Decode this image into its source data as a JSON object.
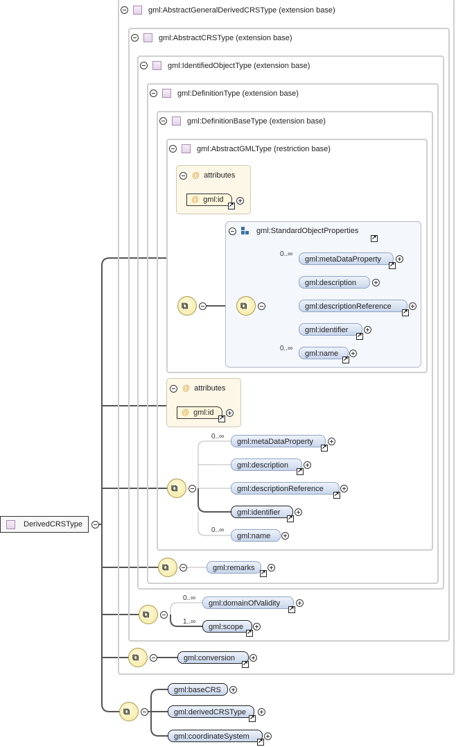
{
  "root": {
    "label": "DerivedCRSType"
  },
  "types": {
    "agd": "gml:AbstractGeneralDerivedCRSType (extension base)",
    "acrs": "gml:AbstractCRSType (extension base)",
    "ido": "gml:IdentifiedObjectType (extension base)",
    "def": "gml:DefinitionType (extension base)",
    "defbase": "gml:DefinitionBaseType (extension base)",
    "agml": "gml:AbstractGMLType (restriction base)"
  },
  "attributes": {
    "title": "attributes",
    "id": "gml:id"
  },
  "group": {
    "name": "gml:StandardObjectProperties"
  },
  "occurrence": {
    "many0": "0..∞",
    "many1": "1..∞"
  },
  "elements": {
    "metaDataProperty": "gml:metaDataProperty",
    "description": "gml:description",
    "descriptionReference": "gml:descriptionReference",
    "identifier": "gml:identifier",
    "name": "gml:name",
    "remarks": "gml:remarks",
    "domainOfValidity": "gml:domainOfValidity",
    "scope": "gml:scope",
    "conversion": "gml:conversion",
    "baseCRS": "gml:baseCRS",
    "derivedCRSType": "gml:derivedCRSType",
    "coordinateSystem": "gml:coordinateSystem"
  },
  "colors": {
    "boxBorder": "#cfcfcf",
    "pillFill": "#c9d6ec",
    "attrFill": "#fdf7e8",
    "compositorFill": "#f3e79a",
    "groupIcon": "#3b6fa8"
  },
  "icons": {
    "collapse": "minus-circle-icon",
    "expand": "plus-circle-icon",
    "link": "link-arrow-icon",
    "type": "type-square-icon",
    "attribute": "at-sign-icon",
    "sequence": "sequence-compositor-icon",
    "group": "group-blocks-icon"
  }
}
